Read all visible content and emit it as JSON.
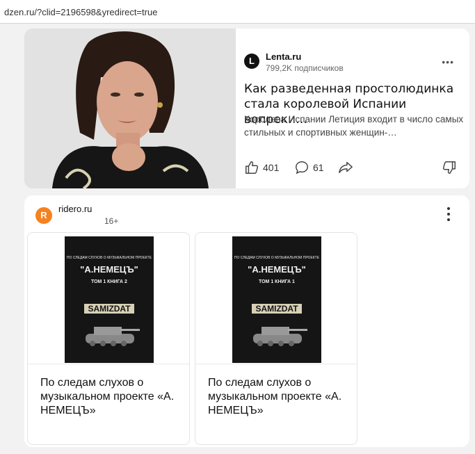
{
  "browser": {
    "url": "dzen.ru/?clid=2196598&yredirect=true"
  },
  "card1": {
    "source_logo": "L",
    "source_name": "Lenta.ru",
    "subscribers": "799,2K подписчиков",
    "title": "Как разведенная простолюдинка стала королевой Испании вопреки…",
    "description": "Королева Испании Летиция входит в число самых стильных и спортивных женщин-…",
    "likes": "401",
    "comments": "61"
  },
  "card2": {
    "source_logo": "R",
    "source_name": "ridero.ru",
    "age_rating": "16+",
    "books": [
      {
        "title": "По следам слухов о музыкальном проекте «А. НЕМЕЦЪ»",
        "cover_subtitle": "ПО СЛЕДАМ СЛУХОВ О МУЗЫКАЛЬНОМ ПРОЕКТЕ",
        "cover_name": "\"А.НЕМЕЦЪ\"",
        "cover_volume": "ТОМ 1 КНИГА 2",
        "cover_brand": "SAMIZDAT"
      },
      {
        "title": "По следам слухов о музыкальном проекте «А. НЕМЕЦЪ»",
        "cover_subtitle": "ПО СЛЕДАМ СЛУХОВ О МУЗЫКАЛЬНОМ ПРОЕКТЕ",
        "cover_name": "\"А.НЕМЕЦЪ\"",
        "cover_volume": "ТОМ 1 КНИГА 1",
        "cover_brand": "SAMIZDAT"
      }
    ]
  }
}
